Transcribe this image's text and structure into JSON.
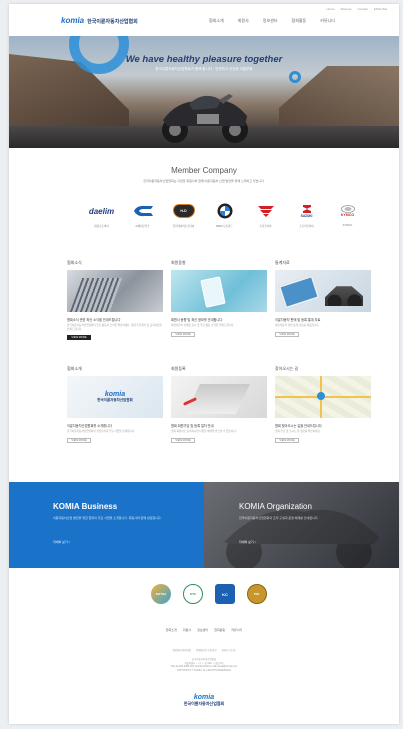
{
  "header": {
    "logo_en": "komia",
    "logo_ko": "한국이륜자동차산업협회",
    "util_links": [
      "Home",
      "Sitemap",
      "Contact",
      "ENGLISH"
    ],
    "nav": [
      "협회소개",
      "회원사",
      "정보센터",
      "협회활동",
      "커뮤니티"
    ]
  },
  "hero": {
    "title": "We have healthy pleasure together",
    "subtitle": "한국이륜자동차산업협회가 함께 합니다 · 안전하고 건강한 이륜문화"
  },
  "member": {
    "title": "Member Company",
    "desc": "한국이륜자동차산업협회는 다양한 회원사와 함께 이륜자동차 산업 발전을 위해 노력하고 있습니다.",
    "brands": [
      {
        "logo": "daelim",
        "name": "대림오토바이"
      },
      {
        "logo": "ck",
        "name": "씨케이모터스"
      },
      {
        "logo": "harley-davidson",
        "name": "할리데이비슨코리아"
      },
      {
        "logo": "bmw",
        "name": "BMW 모토라드"
      },
      {
        "logo": "honda",
        "name": "혼다코리아"
      },
      {
        "logo": "suzuki",
        "name": "스즈키코리아"
      },
      {
        "logo": "kymco",
        "name": "KYMCO"
      }
    ],
    "brand_text": {
      "daelim": "daelim",
      "suzuki": "SUZUKI",
      "kymco": "KYMCO",
      "bmw": "BMW",
      "hd": "H-D"
    }
  },
  "cards": [
    {
      "title": "협회소식",
      "head": "협회소식 관련 최신 소식을 안내드립니다",
      "text": "한국이륜자동차산업협회의 주요 활동과 소식을 확인하세요. 협회 주요행사 및 공지사항을 전해드립니다.",
      "btn": "VIEW MORE"
    },
    {
      "title": "회원동향",
      "head": "회원사 동향 및 최신 정보를 안내합니다",
      "text": "회원사들의 신제품 출시 및 주요 활동 소식을 전해드립니다.",
      "btn": "VIEW MORE"
    },
    {
      "title": "통계자료",
      "head": "이륜자동차 판매 및 등록 통계 자료",
      "text": "이륜자동차 관련 통계 자료를 제공합니다.",
      "btn": "VIEW MORE"
    },
    {
      "title": "협회소개",
      "head": "이륜자동차산업협회를 소개합니다",
      "text": "한국이륜자동차산업협회의 설립목적과 주요 사업을 안내합니다.",
      "btn": "VIEW MORE",
      "img_logo_en": "komia",
      "img_logo_ko": "한국이륜자동차산업협회"
    },
    {
      "title": "회원등록",
      "head": "협회 회원가입 및 등록 절차 안내",
      "text": "협회 회원사로 등록하시면 다양한 혜택을 받으실 수 있습니다.",
      "btn": "VIEW MORE"
    },
    {
      "title": "찾아오시는 길",
      "head": "협회 찾아오시는 길을 안내드립니다",
      "text": "협회 주소 및 오시는 길 정보를 확인하세요.",
      "btn": "VIEW MORE"
    }
  ],
  "banners": [
    {
      "title": "KOMIA Business",
      "text": "이륜자동차산업 발전을 위한 협회의 주요 사업을 소개합니다. 회원사와 함께 성장합니다.",
      "link": "자세히 보기  >"
    },
    {
      "title": "KOMIA Organization",
      "text": "한국이륜자동차산업협회의 조직 구성과 운영 체계를 안내합니다.",
      "link": "자세히 보기  >"
    }
  ],
  "partners": [
    "KOTSA",
    "KTC",
    "KC",
    "POL"
  ],
  "footer": {
    "menu": [
      "협회소개",
      "회원사",
      "정보센터",
      "협회활동",
      "커뮤니티"
    ],
    "links": [
      "개인정보처리방침",
      "이메일무단수집거부",
      "찾아오시는길"
    ],
    "info": [
      "한국이륜자동차산업협회",
      "서울특별시 ○○구 ○○로 000 ○○빌딩 0층",
      "TEL 02-000-0000  FAX 02-000-0000  E-mail komia@komia.or.kr",
      "COPYRIGHT © KOMIA. ALL RIGHTS RESERVED."
    ],
    "logo_en": "komia",
    "logo_ko": "한국이륜자동차산업협회"
  }
}
